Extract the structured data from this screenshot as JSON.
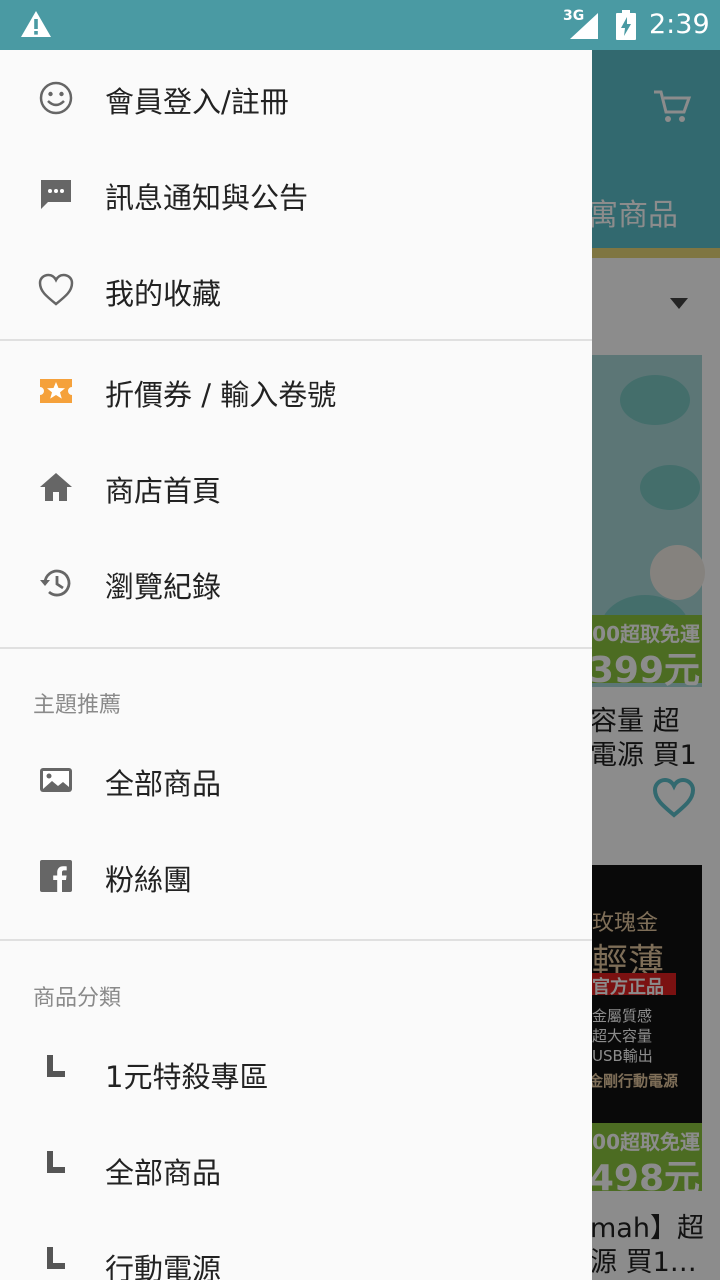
{
  "status_bar": {
    "network_type": "3G",
    "time": "2:39",
    "icons": [
      "warning-icon",
      "signal-icon",
      "battery-charging-icon"
    ]
  },
  "background": {
    "section_title": "寓商品",
    "products": [
      {
        "ribbon_shipping": "00超取免運",
        "ribbon_price": "價399元",
        "title_line1": "容量 超",
        "title_line2": "電源 買1"
      },
      {
        "image_line1": "玫瑰金",
        "image_line2": "輕薄",
        "image_tag": "官方正品",
        "image_features": [
          "金屬質感",
          "超大容量",
          "USB輸出"
        ],
        "image_brand": "金剛行動電源",
        "ribbon_shipping": "00超取免運",
        "ribbon_price": "價498元",
        "title_line1": "mah】超",
        "title_line2": "源 買1…"
      }
    ]
  },
  "drawer": {
    "items_top": [
      {
        "label": "會員登入/註冊",
        "icon": "smiley-icon"
      },
      {
        "label": "訊息通知與公告",
        "icon": "chat-bubble-icon"
      },
      {
        "label": "我的收藏",
        "icon": "heart-outline-icon"
      }
    ],
    "items_mid": [
      {
        "label": "折價券 / 輸入卷號",
        "icon": "ticket-star-icon"
      },
      {
        "label": "商店首頁",
        "icon": "home-icon"
      },
      {
        "label": "瀏覽紀錄",
        "icon": "history-icon"
      }
    ],
    "theme_section": {
      "header": "主題推薦",
      "items": [
        {
          "label": "全部商品",
          "icon": "image-icon"
        },
        {
          "label": "粉絲團",
          "icon": "facebook-icon"
        }
      ]
    },
    "category_section": {
      "header": "商品分類",
      "items": [
        {
          "label": "1元特殺專區",
          "icon": "corner-arrow-icon"
        },
        {
          "label": "全部商品",
          "icon": "corner-arrow-icon"
        },
        {
          "label": "行動電源",
          "icon": "corner-arrow-icon"
        }
      ]
    }
  },
  "colors": {
    "status_bar": "#4a9aa3",
    "header": "#5bbfca",
    "accent_orange": "#f5a13b",
    "ribbon_green": "#8bc53f"
  }
}
